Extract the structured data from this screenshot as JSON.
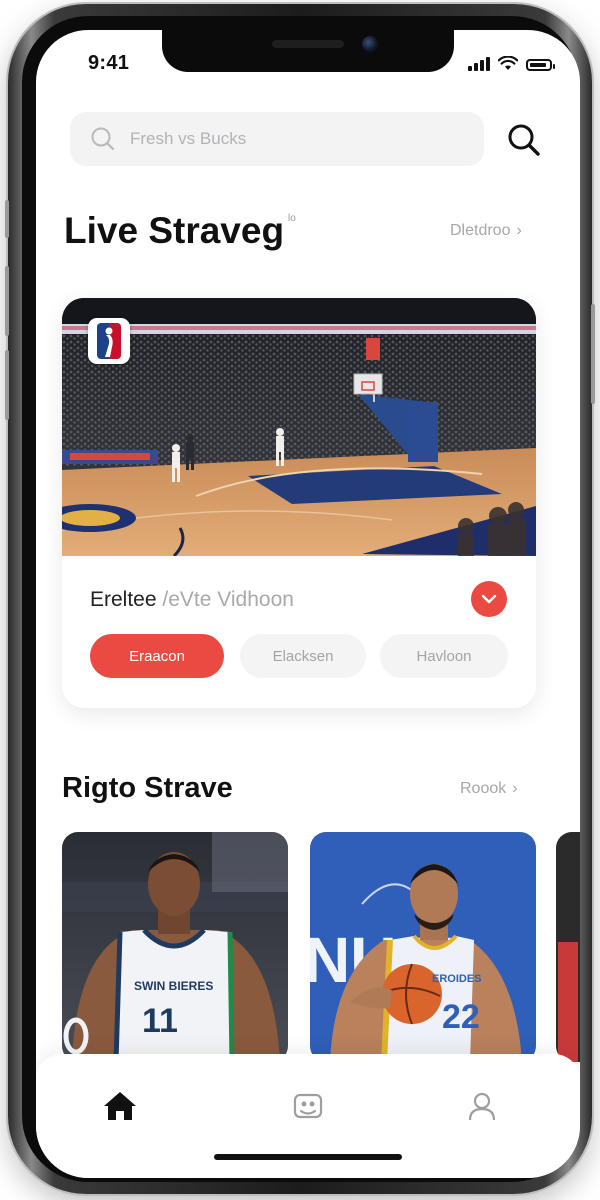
{
  "status_bar": {
    "time": "9:41"
  },
  "search": {
    "placeholder": "Fresh vs Bucks"
  },
  "live_section": {
    "title": "Live Straveg",
    "title_sup": "lo",
    "link": "Dletdroo",
    "link_chevron": "›"
  },
  "live_card": {
    "logo": "nba-logo",
    "title_main": "Ereltee",
    "title_dim": "/eVte Vidhoon",
    "pills": [
      {
        "label": "Eraacon",
        "active": true
      },
      {
        "label": "Elacksen",
        "active": false
      },
      {
        "label": "Havloon",
        "active": false
      }
    ]
  },
  "rising_section": {
    "title": "Rigto Strave",
    "link": "Roook",
    "link_chevron": "›"
  },
  "tiles": [
    {
      "jersey_text": "SWIN BIERES",
      "jersey_number": "11"
    },
    {
      "backdrop_text": "NUJD.",
      "jersey_text": "EROIDES",
      "jersey_number": "22"
    }
  ],
  "tab_bar": {
    "tabs": [
      {
        "icon": "home-icon",
        "active": true
      },
      {
        "icon": "photo-icon",
        "active": false
      },
      {
        "icon": "profile-icon",
        "active": false
      }
    ]
  },
  "colors": {
    "accent": "#ea4a41",
    "text": "#111111",
    "muted": "#a7a7ab",
    "court_blue": "#243b7a",
    "floor": "#d9a06a"
  }
}
